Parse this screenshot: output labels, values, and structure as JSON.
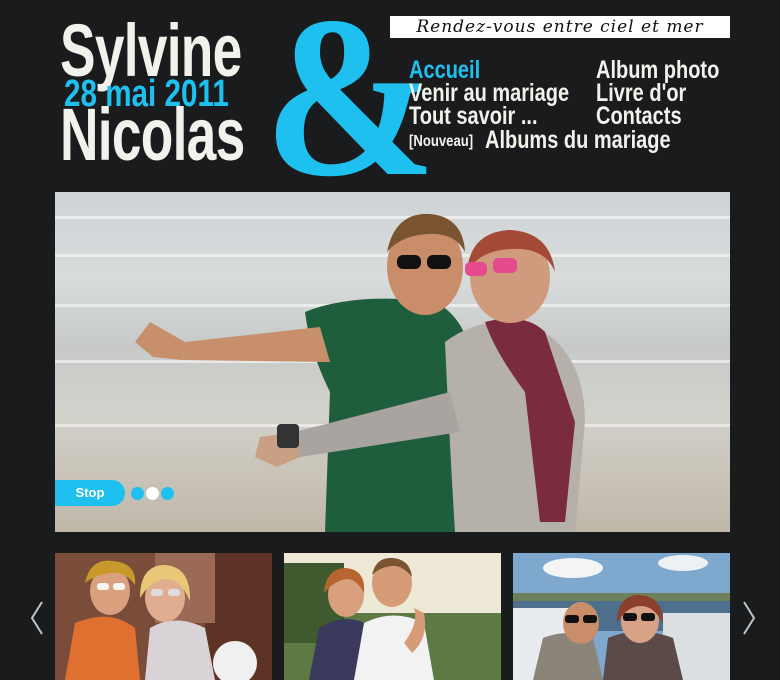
{
  "header": {
    "name_top": "Sylvine",
    "ampersand": "&",
    "name_bottom": "Nicolas",
    "date": "28 mai 2011",
    "tagline": "Rendez-vous entre ciel et mer"
  },
  "nav": {
    "accueil": "Accueil",
    "venir": "Venir au mariage",
    "tout_savoir": "Tout savoir ...",
    "album_photo": "Album photo",
    "livre_dor": "Livre d'or",
    "contacts": "Contacts",
    "nouveau_tag": "[Nouveau]",
    "albums_mariage": "Albums du mariage"
  },
  "slideshow": {
    "stop_label": "Stop",
    "slide_count": 3,
    "active_slide": 2
  },
  "icons": {
    "prev": "chevron-left-icon",
    "next": "chevron-right-icon"
  },
  "colors": {
    "accent": "#1ec0ef",
    "background": "#1a1b1d",
    "text": "#f2f2ec"
  }
}
